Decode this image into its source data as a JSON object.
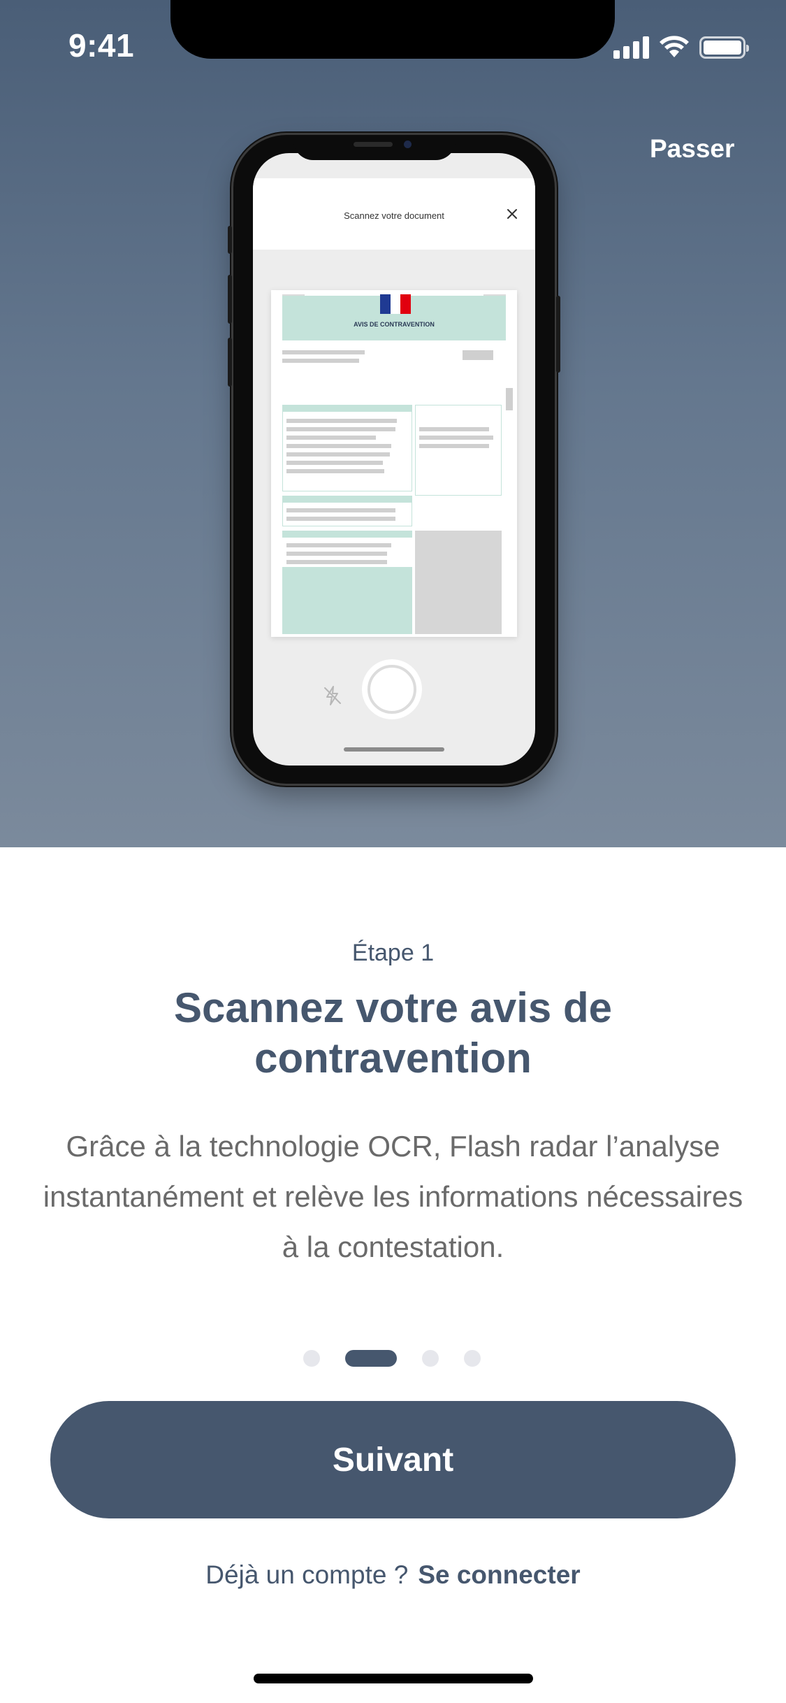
{
  "status_bar": {
    "time": "9:41",
    "signal_icon": "cellular-signal-icon",
    "wifi_icon": "wifi-icon",
    "battery_icon": "battery-icon"
  },
  "header": {
    "skip_label": "Passer"
  },
  "illustration": {
    "scan_screen_title": "Scannez votre document",
    "close_icon": "close-icon",
    "document_title": "AVIS DE CONTRAVENTION",
    "flash_icon": "flash-off-icon",
    "colors": {
      "hero_top": "#4a5e77",
      "hero_bottom": "#7b8a9c",
      "doc_accent": "#c4e3da"
    }
  },
  "onboarding": {
    "step_label": "Étape 1",
    "title": "Scannez votre avis de contravention",
    "description": "Grâce à la technologie OCR, Flash radar l’analyse instantanément et relève les informations nécessaires à la contestation.",
    "page_indicator": {
      "count": 4,
      "active_index": 1
    }
  },
  "actions": {
    "next_label": "Suivant",
    "existing_account_text": "Déjà un compte ?",
    "login_label": "Se connecter"
  },
  "theme": {
    "primary": "#46576e",
    "body_text": "#6a6a6a"
  }
}
